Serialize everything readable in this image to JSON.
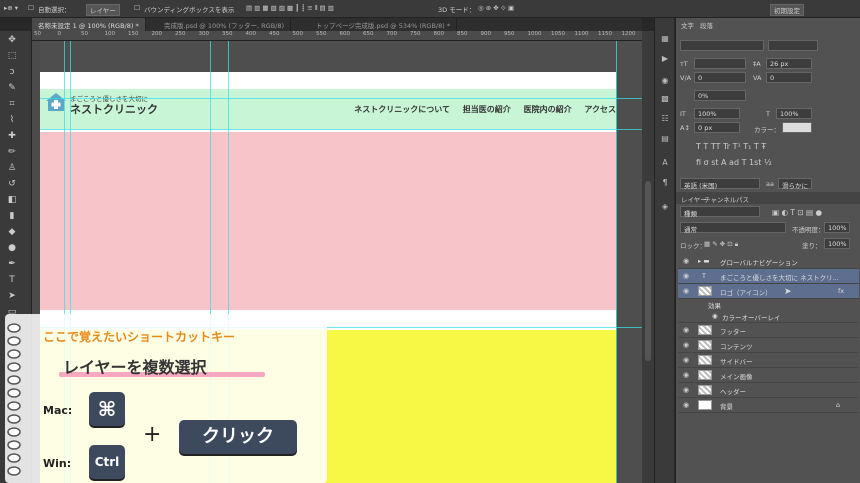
{
  "options_bar": {
    "auto_select_label": "自動選択：",
    "auto_select_value": "レイヤー",
    "bbox_label": "バウンディングボックスを表示",
    "mode_3d": "3D モード：",
    "workspace": "初期設定"
  },
  "tabs": [
    {
      "label": "名称未設定 1 @ 100% (RGB/8) *"
    },
    {
      "label": "完成版.psd @ 100% (フッター, RGB/8)"
    },
    {
      "label": "トップページ完成版.psd @ 534% (RGB/8) *"
    }
  ],
  "ruler_ticks": [
    "50",
    "0",
    "50",
    "100",
    "150",
    "200",
    "250",
    "300",
    "350",
    "400",
    "450",
    "500",
    "550",
    "600",
    "650",
    "700",
    "750",
    "800",
    "850",
    "900",
    "950",
    "1000",
    "1050",
    "1100",
    "1150",
    "1200",
    "1250"
  ],
  "document": {
    "tagline": "まごころと優しさを大切に",
    "logo": "ネストクリニック",
    "nav": [
      "ネストクリニックについて",
      "担当医の紹介",
      "医院内の紹介",
      "アクセス"
    ],
    "colors": {
      "header": "#c8f5d6",
      "pink": "#f6c4c9",
      "yellow": "#f7f745",
      "guide": "#38e0e8"
    }
  },
  "char_panel": {
    "tabs": [
      "文字",
      "段落"
    ],
    "font_size": "26 px",
    "tracking": "0",
    "vscale": "100%",
    "hscale": "100%",
    "baseline": "0 px",
    "color_label": "カラー：",
    "vert_pct": "0%",
    "language": "英語 (米国)",
    "aa": "滑らかに"
  },
  "layers_panel": {
    "tabs": [
      "レイヤー",
      "チャンネル",
      "パス"
    ],
    "filter_kind": "種類",
    "blend_mode": "通常",
    "opacity_label": "不透明度：",
    "opacity": "100%",
    "lock_label": "ロック：",
    "fill_label": "塗り：",
    "fill": "100%",
    "layers": [
      {
        "name": "グローバルナビゲーション",
        "type": "group"
      },
      {
        "name": "まごころと優しさを大切に ネストクリ...",
        "type": "text",
        "selected": true
      },
      {
        "name": "ロゴ（アイコン）",
        "type": "image",
        "selected": true,
        "fx": "fx"
      },
      {
        "name": "効果",
        "type": "effect-header"
      },
      {
        "name": "カラーオーバーレイ",
        "type": "effect"
      },
      {
        "name": "フッター",
        "type": "image"
      },
      {
        "name": "コンテンツ",
        "type": "image"
      },
      {
        "name": "サイドバー",
        "type": "image"
      },
      {
        "name": "メイン画像",
        "type": "image"
      },
      {
        "name": "ヘッダー",
        "type": "image"
      },
      {
        "name": "背景",
        "type": "bg"
      }
    ]
  },
  "overlay": {
    "heading": "ここで覚えたいショートカットキー",
    "title": "レイヤーを複数選択",
    "mac_label": "Mac:",
    "win_label": "Win:",
    "cmd_key": "⌘",
    "ctrl_key": "Ctrl",
    "plus": "+",
    "click_key": "クリック"
  }
}
